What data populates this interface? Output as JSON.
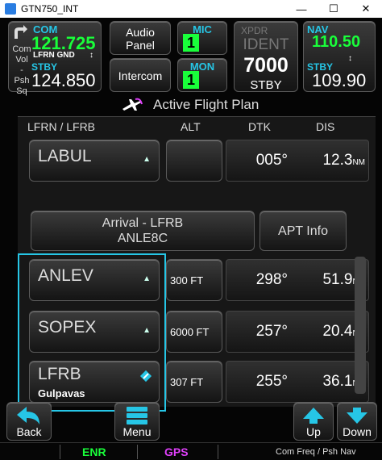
{
  "window": {
    "title": "GTN750_INT",
    "min": "—",
    "max": "☐",
    "close": "✕"
  },
  "com": {
    "title": "COM",
    "active": "121.725",
    "id": "LFRN GND",
    "swap": "↕",
    "stby_label": "STBY",
    "stby": "124.850",
    "side_lines": [
      "Com",
      "Vol",
      "-",
      "Psh",
      "Sq"
    ]
  },
  "audio": {
    "line1": "Audio",
    "line2": "Panel"
  },
  "intercom": {
    "label": "Intercom"
  },
  "mic": {
    "title": "MIC",
    "num": "1"
  },
  "mon": {
    "title": "MON",
    "num": "1"
  },
  "xpdr": {
    "label": "XPDR",
    "ident": "IDENT",
    "code": "7000",
    "mode": "STBY"
  },
  "nav": {
    "title": "NAV",
    "active": "110.50",
    "swap": "↕",
    "stby_label": "STBY",
    "stby": "109.90"
  },
  "page": {
    "title": "Active Flight Plan"
  },
  "fpl": {
    "route": "LFRN / LFRB",
    "col_alt": "ALT",
    "col_dtk": "DTK",
    "col_dis": "DIS",
    "arrival_line1": "Arrival - LFRB",
    "arrival_line2": "ANLE8C",
    "apt_info": "APT Info",
    "rows": [
      {
        "name": "LABUL",
        "alt": "",
        "dtk": "005°",
        "dis": "12.3",
        "unit": "NM",
        "sub": ""
      },
      {
        "name": "ANLEV",
        "alt": "300 FT",
        "dtk": "298°",
        "dis": "51.9",
        "unit": "NM",
        "sub": ""
      },
      {
        "name": "SOPEX",
        "alt": "6000 FT",
        "dtk": "257°",
        "dis": "20.4",
        "unit": "NM",
        "sub": ""
      },
      {
        "name": "LFRB",
        "alt": "307 FT",
        "dtk": "255°",
        "dis": "36.1",
        "unit": "NM",
        "sub": "Gulpavas"
      }
    ]
  },
  "bottom": {
    "back": "Back",
    "menu": "Menu",
    "up": "Up",
    "down": "Down"
  },
  "status": {
    "enr": "ENR",
    "gps": "GPS",
    "com": "Com Freq / Psh Nav"
  },
  "colors": {
    "cyan": "#26c6e6",
    "green": "#19ff3a",
    "magenta": "#e040fb"
  }
}
